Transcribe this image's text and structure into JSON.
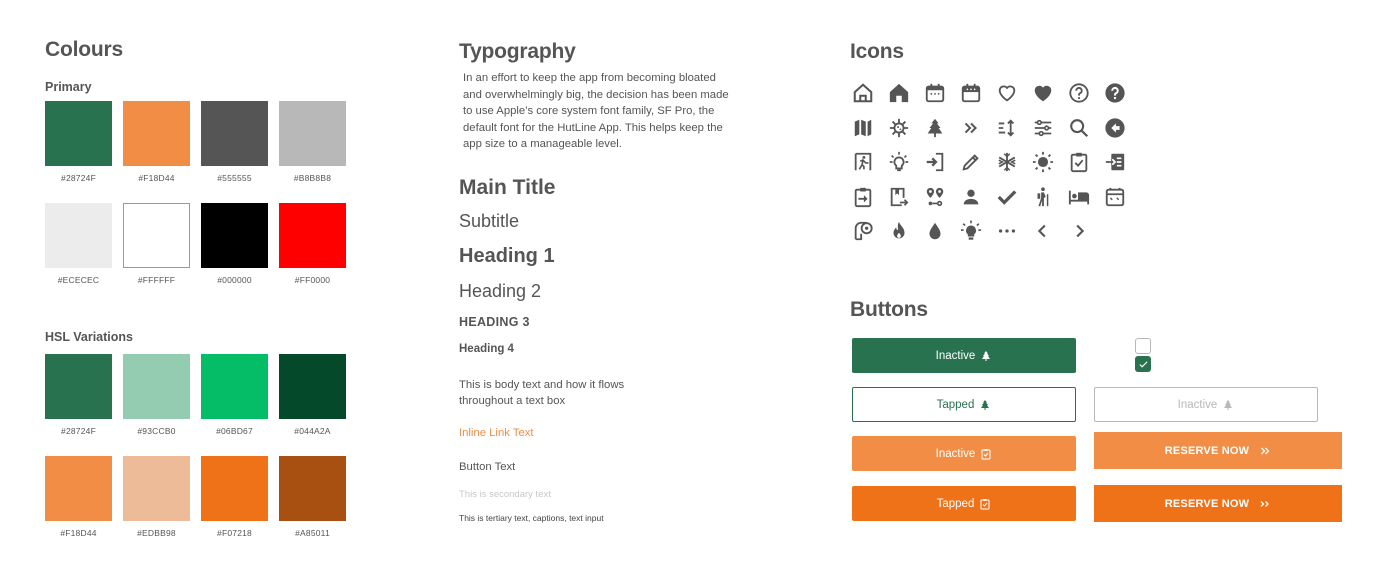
{
  "colours": {
    "title": "Colours",
    "primary": {
      "title": "Primary",
      "swatches": [
        {
          "hex": "#28724F",
          "label": "#28724F"
        },
        {
          "hex": "#F18D44",
          "label": "#F18D44"
        },
        {
          "hex": "#555555",
          "label": "#555555"
        },
        {
          "hex": "#B8B8B8",
          "label": "#B8B8B8"
        },
        {
          "hex": "#ECECEC",
          "label": "#ECECEC"
        },
        {
          "hex": "#FFFFFF",
          "label": "#FFFFFF"
        },
        {
          "hex": "#000000",
          "label": "#000000"
        },
        {
          "hex": "#FF0000",
          "label": "#FF0000"
        }
      ]
    },
    "hsl": {
      "title": "HSL Variations",
      "swatches": [
        {
          "hex": "#28724F",
          "label": "#28724F"
        },
        {
          "hex": "#93CCB0",
          "label": "#93CCB0"
        },
        {
          "hex": "#06BD67",
          "label": "#06BD67"
        },
        {
          "hex": "#044A2A",
          "label": "#044A2A"
        },
        {
          "hex": "#F18D44",
          "label": "#F18D44"
        },
        {
          "hex": "#EDBB98",
          "label": "#EDBB98"
        },
        {
          "hex": "#F07218",
          "label": "#F07218"
        },
        {
          "hex": "#A85011",
          "label": "#A85011"
        }
      ]
    }
  },
  "typography": {
    "title": "Typography",
    "intro": "In an effort to keep the app from becoming bloated and overwhelmingly big, the decision has been made to use Apple’s core system font family, SF Pro, the default font for the HutLine App. This helps keep the app size to a manageable level.",
    "main_title": "Main Title",
    "subtitle": "Subtitle",
    "heading1": "Heading 1",
    "heading2": "Heading 2",
    "heading3": "HEADING 3",
    "heading4": "Heading 4",
    "body": "This is body text and how it flows throughout a text box",
    "link": "Inline Link Text",
    "button_text": "Button Text",
    "secondary": "This is secondary text",
    "tertiary": "This is tertiary text, captions, text input"
  },
  "icons": {
    "title": "Icons",
    "items": [
      "home-outline-icon",
      "home-filled-icon",
      "calendar-outline-icon",
      "calendar-filled-icon",
      "heart-outline-icon",
      "heart-filled-icon",
      "help-outline-icon",
      "help-filled-icon",
      "map-icon",
      "virus-icon",
      "tree-icon",
      "double-chevron-right-icon",
      "sort-icon",
      "sliders-icon",
      "search-icon",
      "back-circle-icon",
      "emergency-exit-icon",
      "lightbulb-outline-icon",
      "login-icon",
      "pencil-icon",
      "snowflake-icon",
      "sun-icon",
      "clipboard-check-icon",
      "checkin-icon",
      "clipboard-arrow-icon",
      "book-export-icon",
      "route-icon",
      "person-icon",
      "checkmark-icon",
      "hiker-icon",
      "bed-icon",
      "stove-icon",
      "toilet-paper-icon",
      "fire-icon",
      "water-drop-icon",
      "lightbulb-filled-icon",
      "more-dots-icon",
      "chevron-left-icon",
      "chevron-right-icon"
    ]
  },
  "buttons": {
    "title": "Buttons",
    "green_inactive": "Inactive",
    "green_tapped": "Tapped",
    "grey_inactive": "Inactive",
    "orange_inactive": "Inactive",
    "orange_tapped": "Tapped",
    "reserve_inactive": "RESERVE NOW",
    "reserve_tapped": "RESERVE NOW",
    "checkbox_unchecked": false,
    "checkbox_checked": true
  },
  "theme": {
    "green": "#28724F",
    "orange": "#F18D44",
    "orange_dark": "#F07218",
    "text": "#555555",
    "grey": "#B8B8B8"
  }
}
